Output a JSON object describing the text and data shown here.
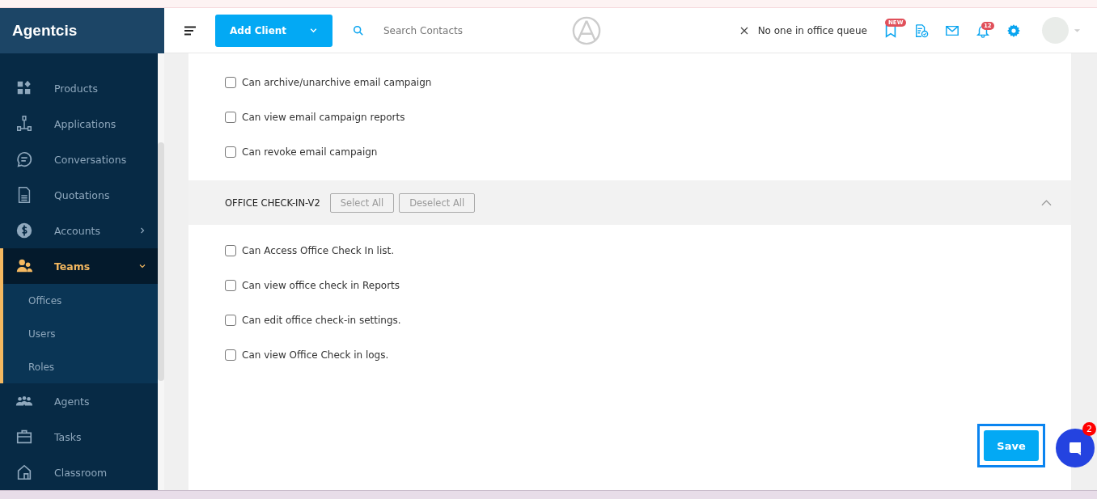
{
  "brand": "Agentcis",
  "sidebar": {
    "items": [
      {
        "label": "Products",
        "selected": false
      },
      {
        "label": "Applications",
        "selected": false
      },
      {
        "label": "Conversations",
        "selected": false
      },
      {
        "label": "Quotations",
        "selected": false
      },
      {
        "label": "Accounts",
        "selected": false,
        "expanded": false
      },
      {
        "label": "Teams",
        "selected": true,
        "expanded": true,
        "children": [
          {
            "label": "Offices"
          },
          {
            "label": "Users"
          },
          {
            "label": "Roles"
          }
        ]
      },
      {
        "label": "Agents",
        "selected": false
      },
      {
        "label": "Tasks",
        "selected": false
      },
      {
        "label": "Classroom",
        "selected": false
      }
    ]
  },
  "header": {
    "add_button": "Add Client",
    "search": {
      "placeholder": "Search Contacts"
    },
    "queue": "No one in office queue",
    "new_badge": "NEW",
    "notification_count": "12"
  },
  "sections": [
    {
      "permissions": [
        {
          "label": "Can archive/unarchive email campaign",
          "checked": false
        },
        {
          "label": "Can view email campaign reports",
          "checked": false
        },
        {
          "label": "Can revoke email campaign",
          "checked": false
        }
      ]
    },
    {
      "title": "OFFICE CHECK-IN-V2",
      "select_all": "Select All",
      "deselect_all": "Deselect All",
      "expanded": true,
      "permissions": [
        {
          "label": "Can Access Office Check In list.",
          "checked": false
        },
        {
          "label": "Can view office check in Reports",
          "checked": false
        },
        {
          "label": "Can edit office check-in settings.",
          "checked": false
        },
        {
          "label": "Can view Office Check in logs.",
          "checked": false
        }
      ]
    }
  ],
  "save_button": "Save",
  "chat_badge": "2"
}
